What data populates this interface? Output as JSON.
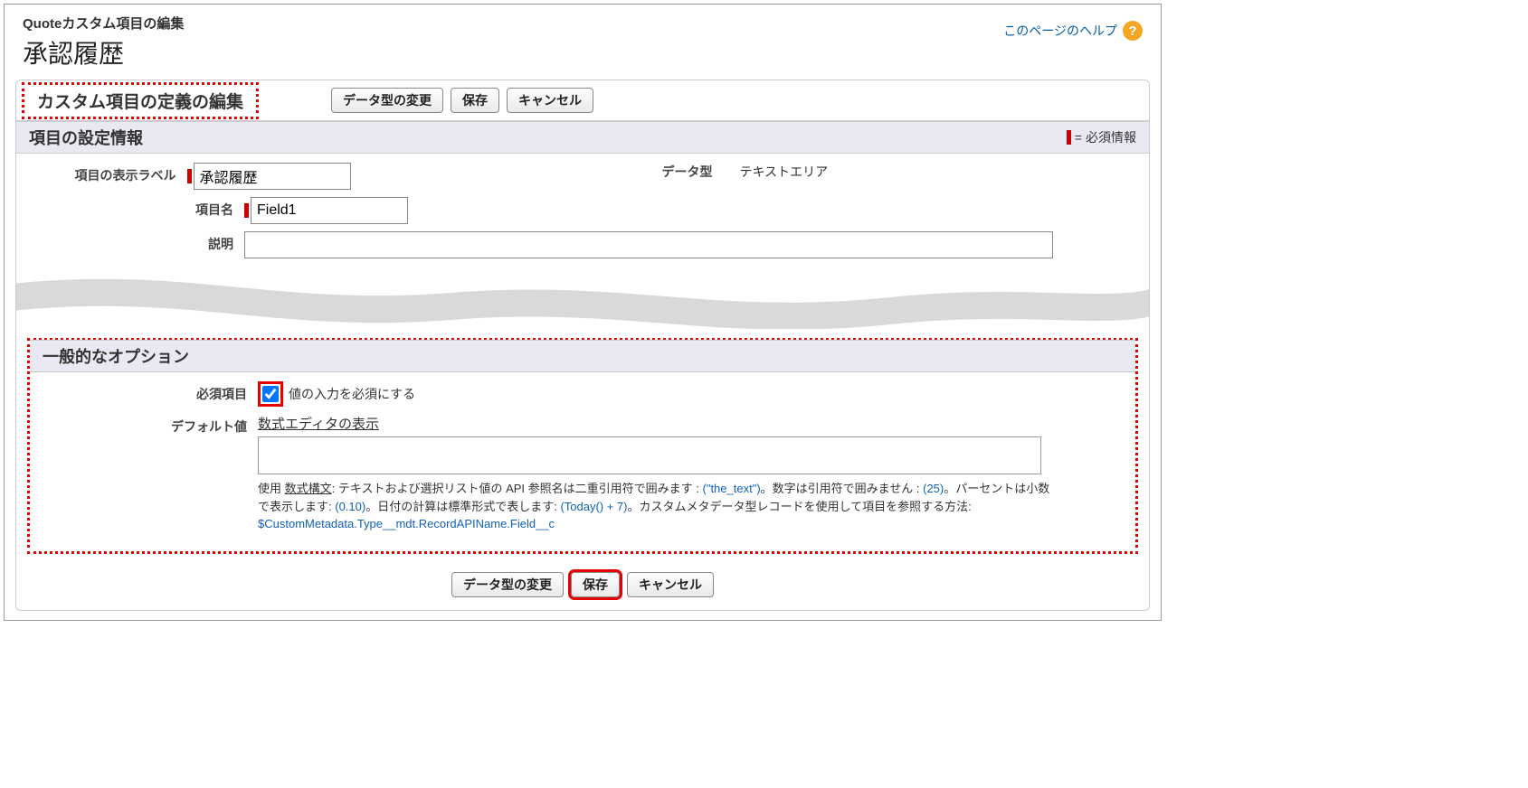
{
  "header": {
    "subtitle": "Quoteカスタム項目の編集",
    "title": "承認履歴",
    "help_link": "このページのヘルプ"
  },
  "panel": {
    "title": "カスタム項目の定義の編集",
    "buttons": {
      "change_type": "データ型の変更",
      "save": "保存",
      "cancel": "キャンセル"
    }
  },
  "section_info": {
    "title": "項目の設定情報",
    "required_legend": "= 必須情報",
    "labels": {
      "display_label": "項目の表示ラベル",
      "field_name": "項目名",
      "description": "説明",
      "data_type": "データ型"
    },
    "values": {
      "display_label": "承認履歴",
      "field_name": "Field1",
      "description": "",
      "data_type": "テキストエリア"
    }
  },
  "section_options": {
    "title": "一般的なオプション",
    "labels": {
      "required": "必須項目",
      "default_value": "デフォルト値"
    },
    "required_text": "値の入力を必須にする",
    "required_checked": true,
    "formula_editor_link": "数式エディタの表示",
    "default_value_formula": "",
    "help_prefix": "使用 ",
    "help_syntax_link": "数式構文",
    "help_text1": ": テキストおよび選択リスト値の API 参照名は二重引用符で囲みます : ",
    "help_example1": "(\"the_text\")",
    "help_text2": "。数字は引用符で囲みません : ",
    "help_example2": "(25)",
    "help_text3": "。パーセントは小数で表示します: ",
    "help_example3": "(0.10)",
    "help_text4": "。日付の計算は標準形式で表します: ",
    "help_example4": "(Today() + 7)",
    "help_text5": "。カスタムメタデータ型レコードを使用して項目を参照する方法: ",
    "help_example5": "$CustomMetadata.Type__mdt.RecordAPIName.Field__c"
  },
  "footer": {
    "change_type": "データ型の変更",
    "save": "保存",
    "cancel": "キャンセル"
  }
}
